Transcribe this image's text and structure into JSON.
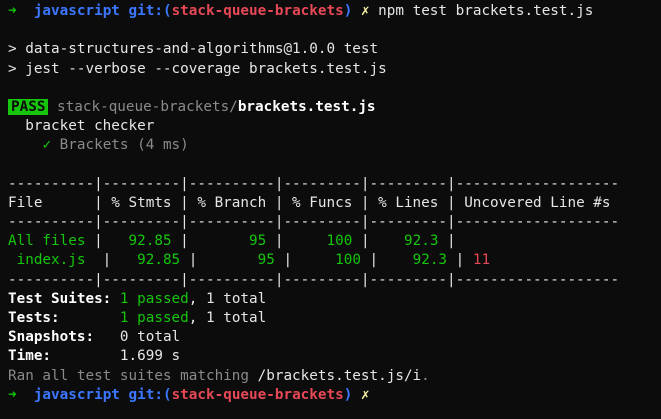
{
  "prompt1": {
    "arrow": "➜",
    "dir": "javascript",
    "git_label": "git:(",
    "branch": "stack-queue-brackets",
    "git_close": ")",
    "dirty": "✗",
    "command": "npm test brackets.test.js"
  },
  "npm_output": {
    "line1": "> data-structures-and-algorithms@1.0.0 test",
    "line2": "> jest --verbose --coverage brackets.test.js"
  },
  "result": {
    "badge": "PASS",
    "path_dim": "stack-queue-brackets/",
    "path_file": "brackets.test.js",
    "suite": "bracket checker",
    "check": "✓",
    "test_name": "Brackets (4 ms)"
  },
  "coverage": {
    "separator": "----------|---------|----------|---------|---------|-------------------",
    "header": "File      | % Stmts | % Branch | % Funcs | % Lines | Uncovered Line #s ",
    "rows": [
      {
        "file": "All files",
        "stmts": "92.85",
        "branch": "95",
        "funcs": "100",
        "lines": "92.3",
        "uncovered": ""
      },
      {
        "file": " index.js",
        "stmts": "92.85",
        "branch": "95",
        "funcs": "100",
        "lines": "92.3",
        "uncovered": "11"
      }
    ]
  },
  "summary": {
    "suites_label": "Test Suites: ",
    "suites_passed": "1 passed",
    "suites_total": ", 1 total",
    "tests_label": "Tests:       ",
    "tests_passed": "1 passed",
    "tests_total": ", 1 total",
    "snapshots_label": "Snapshots:   ",
    "snapshots_value": "0 total",
    "time_label": "Time:        ",
    "time_value": "1.699 s",
    "ran_prefix": "Ran all test suites matching ",
    "ran_pattern": "/brackets.test.js/i",
    "ran_suffix": "."
  },
  "prompt2": {
    "arrow": "➜",
    "dir": "javascript",
    "git_label": "git:(",
    "branch": "stack-queue-brackets",
    "git_close": ")",
    "dirty": "✗"
  }
}
